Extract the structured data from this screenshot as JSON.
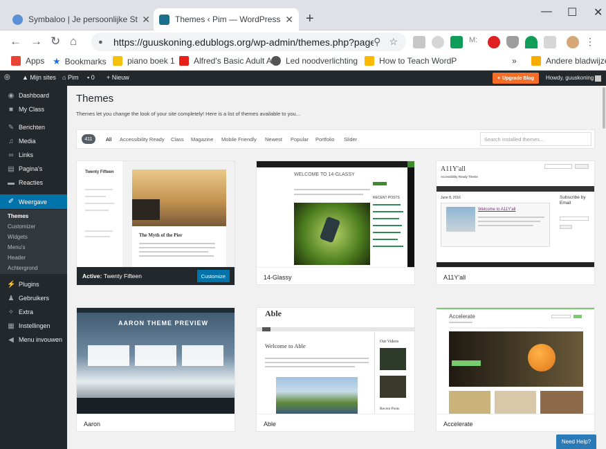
{
  "browser": {
    "tabs": [
      {
        "title": "Symbaloo | Je persoonlijke Startpagina",
        "icon": "symbaloo-icon",
        "color": "#5b8fd6"
      },
      {
        "title": "Themes ‹ Pim — WordPress",
        "icon": "wordpress-icon",
        "color": "#1e6f8b"
      }
    ],
    "new_tab": "+",
    "url": "https://guuskoning.edublogs.org/wp-admin/themes.php?page=...",
    "window_controls": [
      "—",
      "☐",
      "✕"
    ],
    "bookmarks": [
      {
        "label": "Apps",
        "icon": "apps-grid-icon",
        "color": "#ea4335"
      },
      {
        "label": "Bookmarks",
        "icon": "star-icon",
        "color": "#1a73e8"
      },
      {
        "label": "piano boek 1",
        "icon": "piano-icon",
        "color": "#f4c20d"
      },
      {
        "label": "Alfred's Basic Adult A",
        "icon": "youtube-icon",
        "color": "#e62117"
      },
      {
        "label": "Led noodverlichting",
        "icon": "lamp-icon",
        "color": "#555"
      },
      {
        "label": "How to Teach WordP",
        "icon": "bing-icon",
        "color": "#ffb900"
      },
      {
        "label": "Andere bladwijzers",
        "icon": "folder-icon",
        "color": "#f9ab00"
      }
    ],
    "overflow": "»"
  },
  "adminbar": {
    "my_sites": "Mijn sites",
    "site": "Pim",
    "comments": "0",
    "new": "Nieuw",
    "upgrade": "Upgrade Blog",
    "howdy": "Howdy, guuskoning"
  },
  "sidebar": {
    "items": [
      {
        "label": "Dashboard",
        "icon": "dashboard-icon"
      },
      {
        "label": "My Class",
        "icon": "class-icon"
      },
      {
        "label": "Berichten",
        "icon": "pin-icon"
      },
      {
        "label": "Media",
        "icon": "media-icon"
      },
      {
        "label": "Links",
        "icon": "link-icon"
      },
      {
        "label": "Pagina's",
        "icon": "pages-icon"
      },
      {
        "label": "Reacties",
        "icon": "comments-icon"
      },
      {
        "label": "Weergave",
        "icon": "brush-icon"
      },
      {
        "label": "Plugins",
        "icon": "plugin-icon"
      },
      {
        "label": "Gebruikers",
        "icon": "users-icon"
      },
      {
        "label": "Extra",
        "icon": "tools-icon"
      },
      {
        "label": "Instellingen",
        "icon": "settings-icon"
      },
      {
        "label": "Menu invouwen",
        "icon": "collapse-icon"
      }
    ],
    "submenu": [
      "Themes",
      "Customizer",
      "Widgets",
      "Menu's",
      "Header",
      "Achtergrond"
    ]
  },
  "page": {
    "title": "Themes",
    "intro": "Themes let you change the look of your site completely! Here is a list of themes available to you...",
    "count": "411",
    "filters": [
      "All",
      "Accessibility Ready",
      "Class",
      "Magazine",
      "Mobile Friendly",
      "Newest",
      "Popular",
      "Portfolio",
      "Slider"
    ],
    "search_placeholder": "Search installed themes..."
  },
  "themes": [
    {
      "name": "Twenty Fifteen",
      "active_label": "Active:",
      "customize": "Customize",
      "preview": {
        "site": "Twenty Fifteen",
        "post_title": "The Myth of the Pier"
      }
    },
    {
      "name": "14-Glassy",
      "preview": {
        "heading": "WELCOME TO 14-GLASSY",
        "side": "RECENT POSTS"
      }
    },
    {
      "name": "A11Y'all",
      "preview": {
        "logo": "A11Y'all",
        "tagline": "Accessibility Ready Theme",
        "date": "June 8, 2016",
        "post": "Welcome to A11Y'all",
        "subscribe": "Subscribe by Email"
      }
    },
    {
      "name": "Aaron",
      "preview": {
        "title": "AARON THEME PREVIEW"
      }
    },
    {
      "name": "Able",
      "preview": {
        "logo": "Able",
        "post": "Welcome to Able",
        "videos": "Our Videos",
        "recent": "Recent Posts"
      }
    },
    {
      "name": "Accelerate",
      "preview": {
        "logo": "Accelerate"
      }
    }
  ],
  "help": "Need Help?"
}
